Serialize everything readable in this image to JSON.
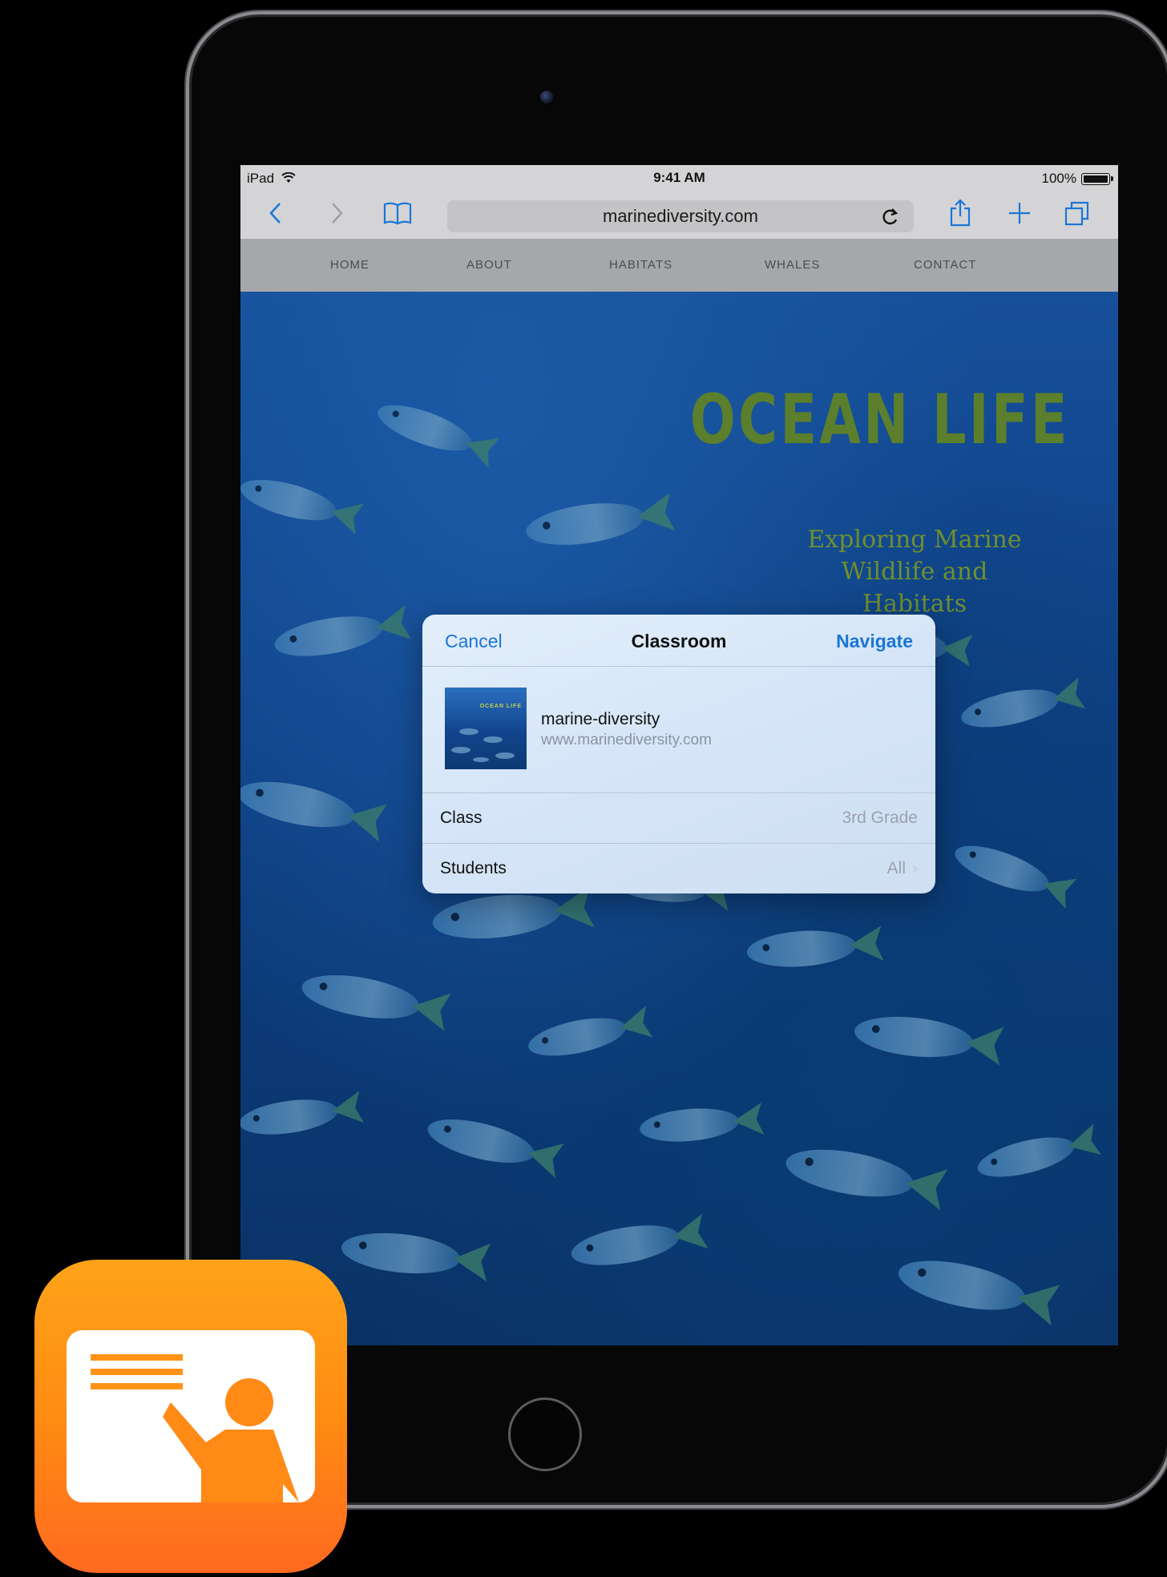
{
  "status_bar": {
    "carrier": "iPad",
    "time": "9:41 AM",
    "battery": "100%"
  },
  "toolbar": {
    "url": "marinediversity.com"
  },
  "site_nav": [
    "HOME",
    "ABOUT",
    "HABITATS",
    "WHALES",
    "CONTACT"
  ],
  "hero": {
    "title": "OCEAN LIFE",
    "subtitle_line1": "Exploring Marine",
    "subtitle_line2": "Wildlife and Habitats"
  },
  "popover": {
    "cancel": "Cancel",
    "title": "Classroom",
    "navigate": "Navigate",
    "item": {
      "name": "marine-diversity",
      "url": "www.marinediversity.com",
      "thumb_title": "OCEAN LIFE"
    },
    "rows": [
      {
        "label": "Class",
        "value": "3rd Grade"
      },
      {
        "label": "Students",
        "value": "All"
      }
    ]
  },
  "colors": {
    "accent": "#1a76d6",
    "hero_title": "#5b7f2c",
    "app_icon": "#ff8c12"
  }
}
